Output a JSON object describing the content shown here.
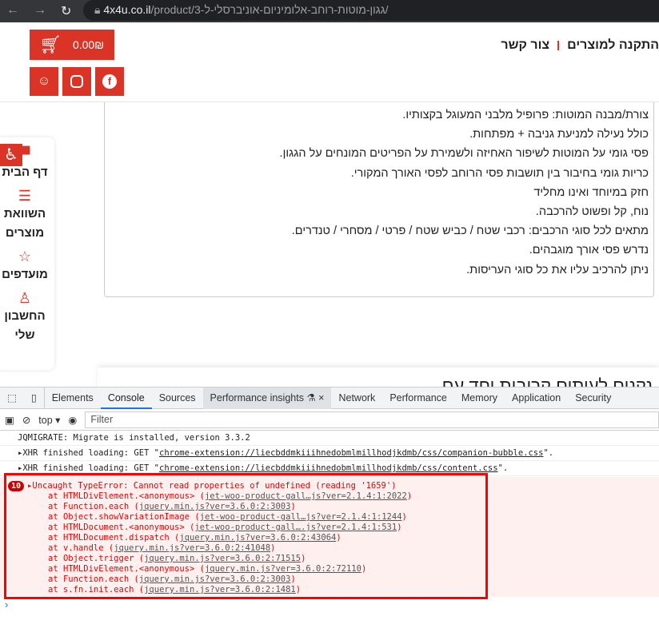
{
  "browser": {
    "url_host": "4x4u.co.il",
    "url_path": "/product/גגון-מוטות-רוחב-אלומיניום-אוניברסלי-ל-3/"
  },
  "header": {
    "cart_total": "0.00₪",
    "nav": [
      "התקנה למוצרים",
      "צור קשר"
    ],
    "social": [
      "waze",
      "instagram",
      "facebook"
    ]
  },
  "description": [
    "צורת/מבנה המוטות: פרופיל מלבני המעוגל בקצותיו.",
    "כולל נעילה למניעת גניבה + מפתחות.",
    "פסי גומי על המוטות לשיפור האחיזה ולשמירת על הפריטים המונחים על הגגון.",
    "כריות גומי בחיבור בין תושבות פסי הרוחב לפסי האורך המקורי.",
    "חזק במיוחד ואינו מחליד",
    "נוח, קל ופשוט להרכבה.",
    "מתאים לכל סוגי הרכבים: רכבי שטח / כביש שטח / פרטי / מסחרי / טנדרים.",
    "נדרש פסי אורך מוגבהים.",
    "ניתן להרכיב עליו את כל סוגי העריסות."
  ],
  "sidebar": {
    "items": [
      {
        "label": "דף הבית",
        "icon": "store-icon"
      },
      {
        "label": "השוואת מוצרים",
        "icon": "checklist-icon"
      },
      {
        "label": "מועדפים",
        "icon": "star-icon"
      },
      {
        "label": "החשבון שלי",
        "icon": "user-icon"
      }
    ]
  },
  "section_heading": "נקנים לעיתים קרובות יחד עם",
  "devtools": {
    "tabs": [
      "Elements",
      "Console",
      "Sources",
      "Performance insights",
      "Network",
      "Performance",
      "Memory",
      "Application",
      "Security"
    ],
    "active_tab": "Console",
    "context": "top ▾",
    "filter_placeholder": "Filter",
    "logs": [
      {
        "text": "JQMIGRATE: Migrate is installed, version 3.3.2"
      },
      {
        "prefix": "▸XHR finished loading: GET \"",
        "link": "chrome-extension://liecbddmkiiihnedobmlmillhodjkdmb/css/companion-bubble.css",
        "suffix": "\"."
      },
      {
        "prefix": "▸XHR finished loading: GET \"",
        "link": "chrome-extension://liecbddmkiiihnedobmlmillhodjkdmb/css/content.css",
        "suffix": "\"."
      }
    ],
    "error": {
      "count": "10",
      "message": "▸Uncaught TypeError: Cannot read properties of undefined (reading '1659')",
      "stack": [
        [
          "at HTMLDivElement.<anonymous> (",
          "jet-woo-product-gall…js?ver=2.1.4:1:2022"
        ],
        [
          "at Function.each (",
          "jquery.min.js?ver=3.6.0:2:3003"
        ],
        [
          "at Object.showVariationImage (",
          "jet-woo-product-gall…js?ver=2.1.4:1:1244"
        ],
        [
          "at HTMLDocument.<anonymous> (",
          "jet-woo-product-gall….js?ver=2.1.4:1:531"
        ],
        [
          "at HTMLDocument.dispatch (",
          "jquery.min.js?ver=3.6.0:2:43064"
        ],
        [
          "at v.handle (",
          "jquery.min.js?ver=3.6.0:2:41048"
        ],
        [
          "at Object.trigger (",
          "jquery.min.js?ver=3.6.0:2:71515"
        ],
        [
          "at HTMLDivElement.<anonymous> (",
          "jquery.min.js?ver=3.6.0:2:72110"
        ],
        [
          "at Function.each (",
          "jquery.min.js?ver=3.6.0:2:3003"
        ],
        [
          "at s.fn.init.each (",
          "jquery.min.js?ver=3.6.0:2:1481"
        ]
      ]
    },
    "prompt": "›"
  }
}
